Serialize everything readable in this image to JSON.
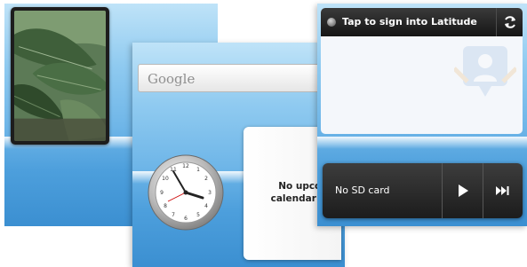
{
  "search": {
    "label": "Google"
  },
  "calendar": {
    "message": "No upcoming\ncalendar events"
  },
  "latitude": {
    "title": "Tap to sign into Latitude"
  },
  "music": {
    "status": "No SD card"
  },
  "icons": {
    "search": "search-icon",
    "refresh": "refresh-icon",
    "play": "play-icon",
    "next": "next-track-icon"
  },
  "colors": {
    "wallpaper": "#6fb6e8",
    "widget_dark": "#1c1c1c"
  }
}
